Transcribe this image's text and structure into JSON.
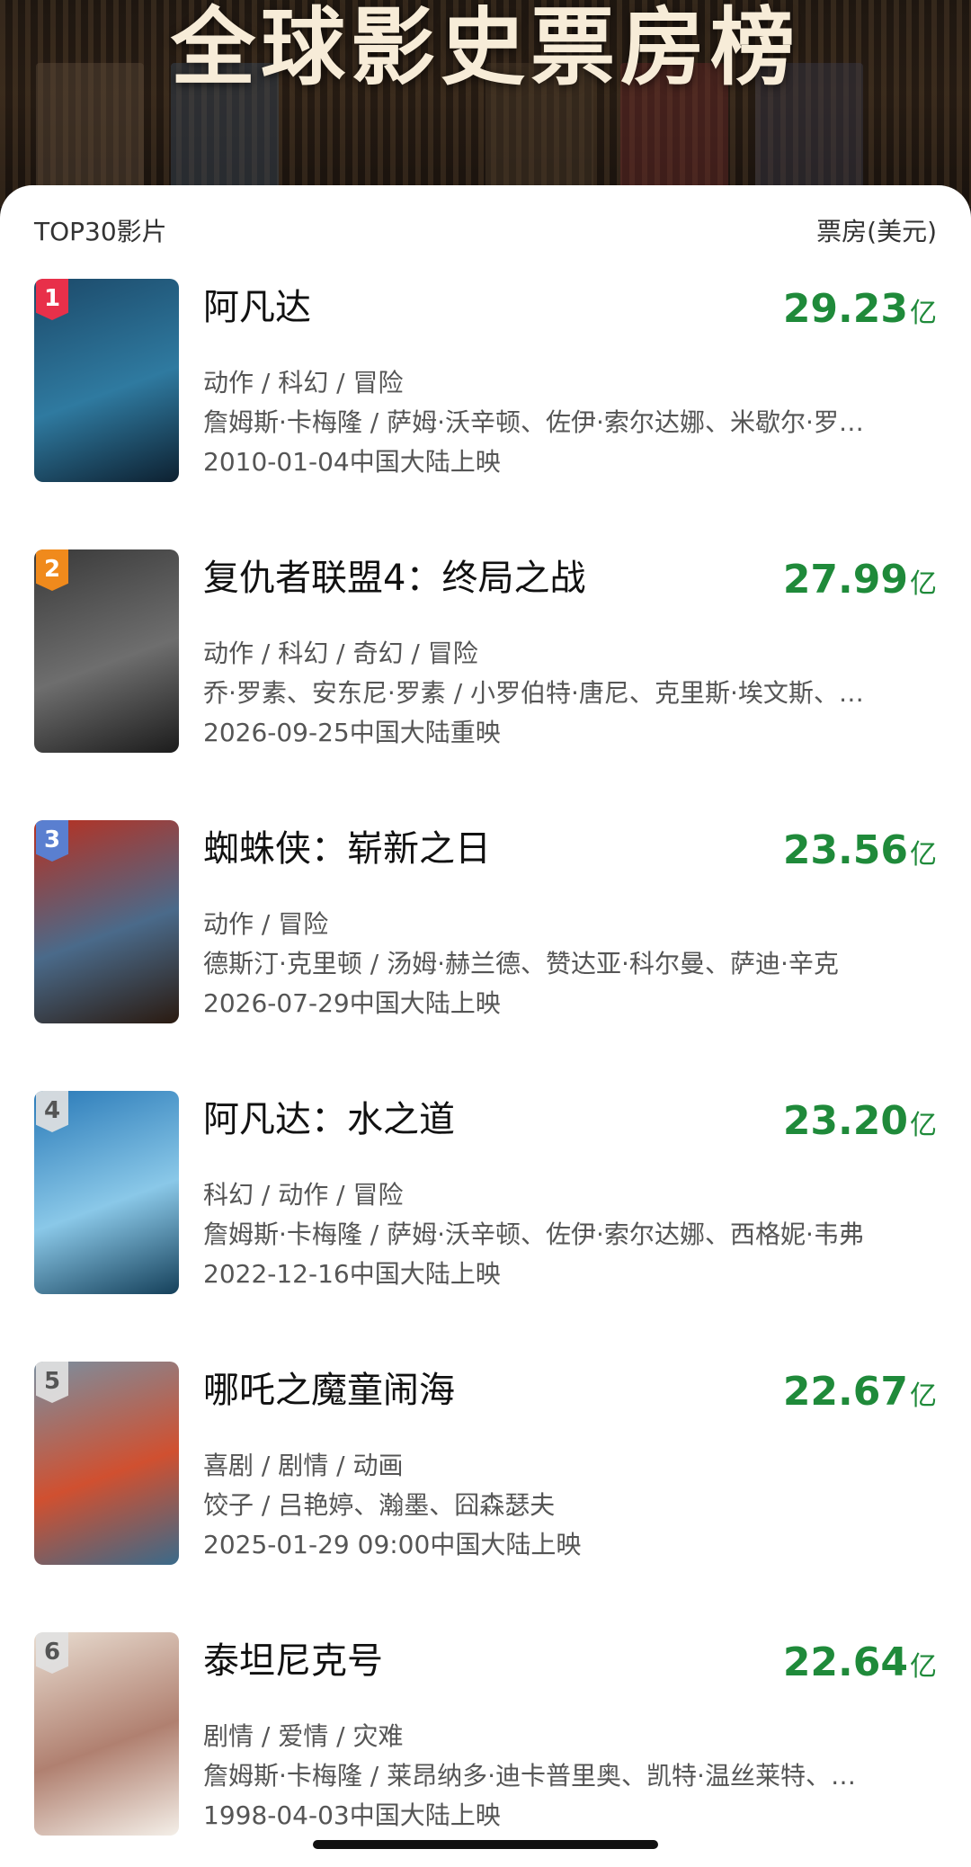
{
  "header": {
    "title": "全球影史票房榜"
  },
  "list": {
    "left_label": "TOP30影片",
    "right_label": "票房(美元)",
    "items": [
      {
        "rank": "1",
        "title": "阿凡达",
        "gross": "29.23",
        "unit": "亿",
        "genre": "动作 / 科幻 / 冒险",
        "cast": "詹姆斯·卡梅隆 / 萨姆·沃辛顿、佐伊·索尔达娜、米歇尔·罗…",
        "date": "2010-01-04中国大陆上映",
        "poster_colors": [
          "#1c4a6a",
          "#2f7aa0",
          "#0d2030"
        ],
        "rank_color": "#e8304a"
      },
      {
        "rank": "2",
        "title": "复仇者联盟4：终局之战",
        "gross": "27.99",
        "unit": "亿",
        "genre": "动作 / 科幻 / 奇幻 / 冒险",
        "cast": "乔·罗素、安东尼·罗素 / 小罗伯特·唐尼、克里斯·埃文斯、…",
        "date": "2026-09-25中国大陆重映",
        "poster_colors": [
          "#3a3a3a",
          "#6e6e6e",
          "#1c1c1c"
        ],
        "rank_color": "#f08a1c"
      },
      {
        "rank": "3",
        "title": "蜘蛛侠：崭新之日",
        "gross": "23.56",
        "unit": "亿",
        "genre": "动作 / 冒险",
        "cast": "德斯汀·克里顿 / 汤姆·赫兰德、赞达亚·科尔曼、萨迪·辛克",
        "date": "2026-07-29中国大陆上映",
        "poster_colors": [
          "#b83020",
          "#4a6a8a",
          "#2a1a10"
        ],
        "rank_color": "#5a7fd0"
      },
      {
        "rank": "4",
        "title": "阿凡达：水之道",
        "gross": "23.20",
        "unit": "亿",
        "genre": "科幻 / 动作 / 冒险",
        "cast": "詹姆斯·卡梅隆 / 萨姆·沃辛顿、佐伊·索尔达娜、西格妮·韦弗",
        "date": "2022-12-16中国大陆上映",
        "poster_colors": [
          "#2a7ab8",
          "#8ac8e8",
          "#15405a"
        ],
        "rank_color": "gray"
      },
      {
        "rank": "5",
        "title": "哪吒之魔童闹海",
        "gross": "22.67",
        "unit": "亿",
        "genre": "喜剧 / 剧情 / 动画",
        "cast": "饺子 / 吕艳婷、瀚墨、囧森瑟夫",
        "date": "2025-01-29 09:00中国大陆上映",
        "poster_colors": [
          "#7a8fa0",
          "#d05030",
          "#3a6a8a"
        ],
        "rank_color": "gray"
      },
      {
        "rank": "6",
        "title": "泰坦尼克号",
        "gross": "22.64",
        "unit": "亿",
        "genre": "剧情 / 爱情 / 灾难",
        "cast": "詹姆斯·卡梅隆 / 莱昂纳多·迪卡普里奥、凯特·温丝莱特、…",
        "date": "1998-04-03中国大陆上映",
        "poster_colors": [
          "#e8dcd0",
          "#b08070",
          "#f4efe8"
        ],
        "rank_color": "gray"
      }
    ]
  }
}
